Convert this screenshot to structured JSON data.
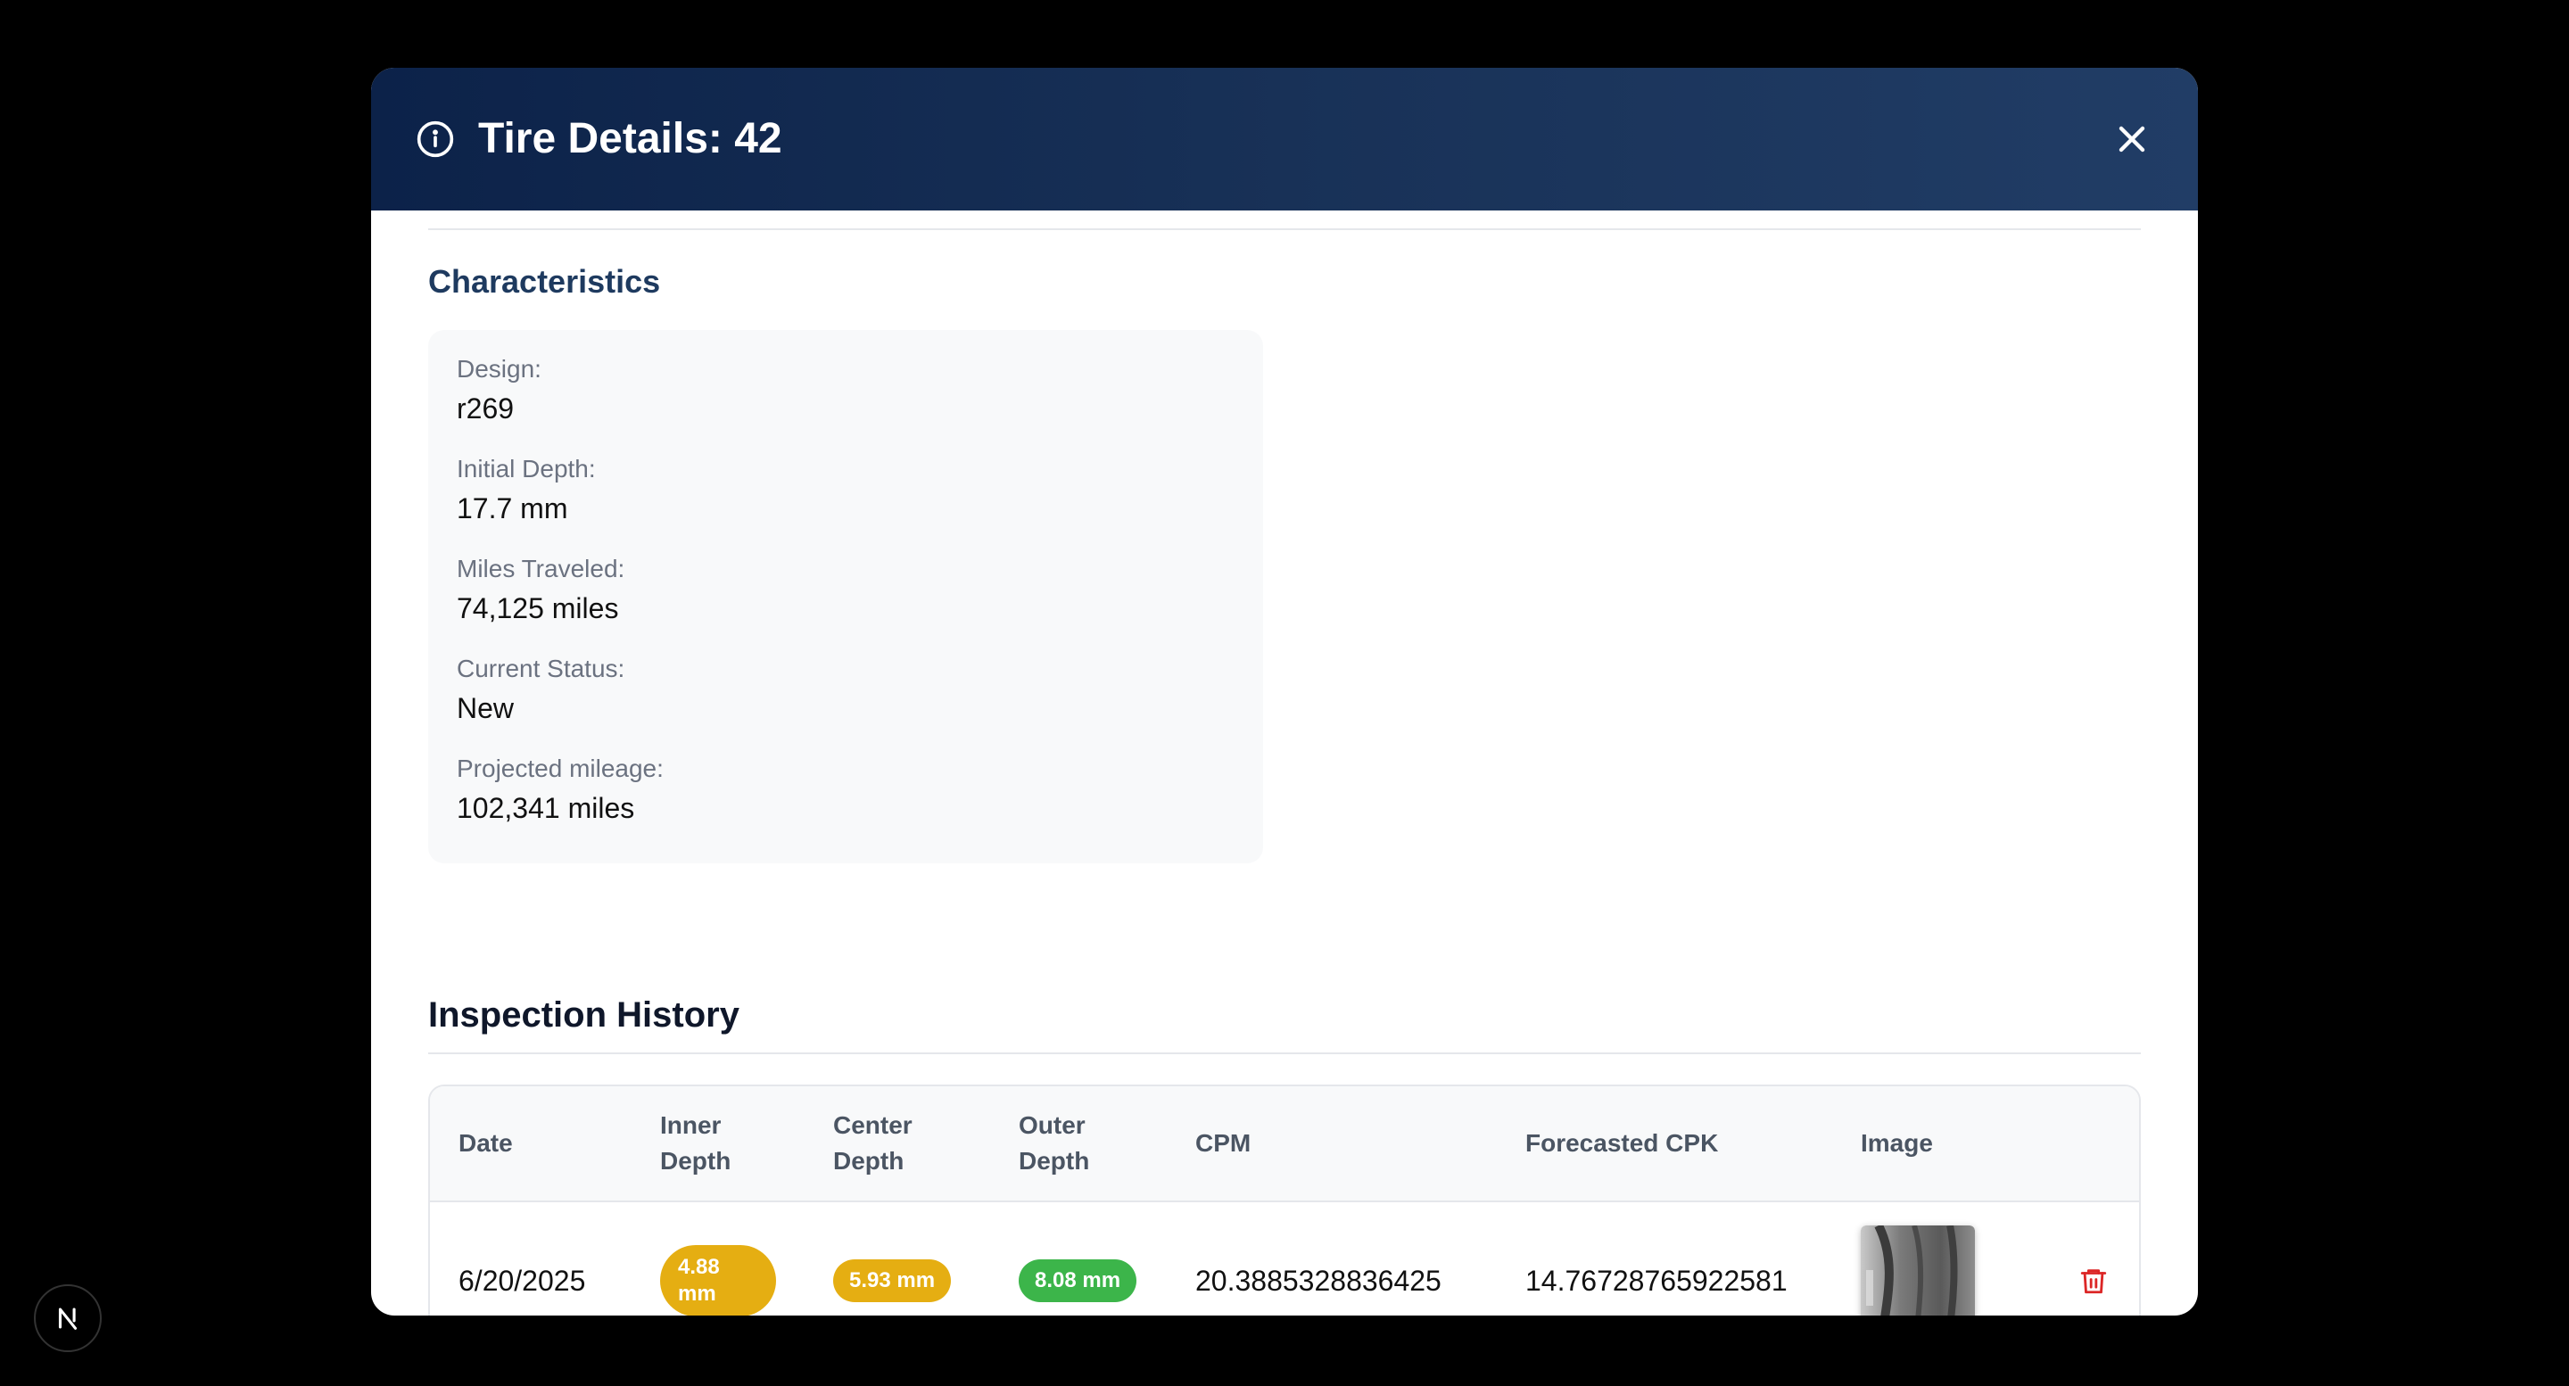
{
  "modal": {
    "title": "Tire Details: 42",
    "header_icon": "info-circle-icon",
    "close_icon": "close-icon"
  },
  "characteristics": {
    "heading": "Characteristics",
    "items": [
      {
        "label": "Design:",
        "value": "r269"
      },
      {
        "label": "Initial Depth:",
        "value": "17.7 mm"
      },
      {
        "label": "Miles Traveled:",
        "value": "74,125 miles"
      },
      {
        "label": "Current Status:",
        "value": "New"
      },
      {
        "label": "Projected mileage:",
        "value": "102,341 miles"
      }
    ]
  },
  "inspection": {
    "heading": "Inspection History",
    "columns": [
      "Date",
      "Inner Depth",
      "Center Depth",
      "Outer Depth",
      "CPM",
      "Forecasted CPK",
      "Image"
    ],
    "rows": [
      {
        "date": "6/20/2025",
        "inner_depth": "4.88 mm",
        "center_depth": "5.93 mm",
        "outer_depth": "8.08 mm",
        "cpm": "20.3885328836425",
        "forecasted_cpk": "14.76728765922581",
        "image_icon": "tire-thumbnail-image",
        "delete_icon": "trash-icon"
      }
    ]
  },
  "colors": {
    "header_start": "#0c2249",
    "header_end": "#213d66",
    "badge_yellow": "#e5ae12",
    "badge_green": "#3cb54a",
    "delete_red": "#dc2626"
  },
  "nextjs_badge": "nextjs-logo-icon"
}
